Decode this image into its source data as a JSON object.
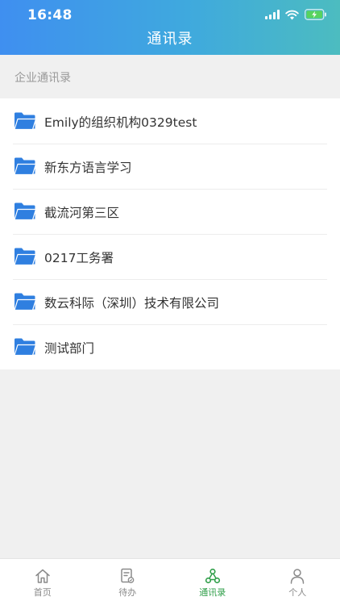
{
  "status_bar": {
    "time": "16:48",
    "icons": [
      "signal-icon",
      "wifi-icon",
      "battery-charging-icon"
    ]
  },
  "header": {
    "title": "通讯录"
  },
  "section": {
    "label": "企业通讯录"
  },
  "list": {
    "icon": "folder-icon",
    "icon_color": "#2f7fe0",
    "items": [
      {
        "label": "Emily的组织机构0329test"
      },
      {
        "label": "新东方语言学习"
      },
      {
        "label": "截流河第三区"
      },
      {
        "label": "0217工务署"
      },
      {
        "label": "数云科际（深圳）技术有限公司"
      },
      {
        "label": "测试部门"
      }
    ]
  },
  "tabbar": {
    "active_color": "#2e9e48",
    "inactive_color": "#8a8a8a",
    "tabs": [
      {
        "label": "首页",
        "icon": "home-icon",
        "active": false
      },
      {
        "label": "待办",
        "icon": "todo-icon",
        "active": false
      },
      {
        "label": "通讯录",
        "icon": "contacts-icon",
        "active": true
      },
      {
        "label": "个人",
        "icon": "person-icon",
        "active": false
      }
    ]
  }
}
